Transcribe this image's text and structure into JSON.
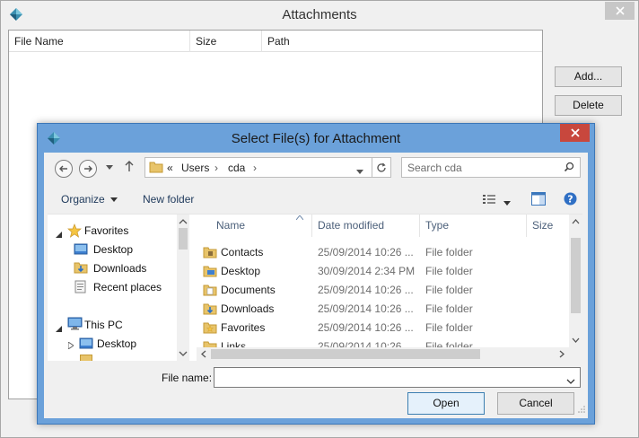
{
  "background_window": {
    "title": "Attachments",
    "columns": [
      "File Name",
      "Size",
      "Path"
    ],
    "add_label": "Add...",
    "delete_label": "Delete"
  },
  "dialog": {
    "title": "Select File(s) for Attachment",
    "breadcrumb": {
      "overflow": "«",
      "segments": [
        "Users",
        "cda"
      ]
    },
    "search_placeholder": "Search cda",
    "organize_label": "Organize",
    "new_folder_label": "New folder",
    "tree": [
      {
        "label": "Favorites",
        "icon": "star-icon"
      },
      {
        "label": "Desktop",
        "icon": "desktop-folder-icon"
      },
      {
        "label": "Downloads",
        "icon": "downloads-folder-icon"
      },
      {
        "label": "Recent places",
        "icon": "recent-places-icon"
      },
      {
        "label": "This PC",
        "icon": "computer-icon"
      },
      {
        "label": "Desktop",
        "icon": "desktop-folder-icon"
      }
    ],
    "columns": [
      "Name",
      "Date modified",
      "Type",
      "Size"
    ],
    "files": [
      {
        "name": "Contacts",
        "date": "25/09/2014 10:26 ...",
        "type": "File folder"
      },
      {
        "name": "Desktop",
        "date": "30/09/2014 2:34 PM",
        "type": "File folder"
      },
      {
        "name": "Documents",
        "date": "25/09/2014 10:26 ...",
        "type": "File folder"
      },
      {
        "name": "Downloads",
        "date": "25/09/2014 10:26 ...",
        "type": "File folder"
      },
      {
        "name": "Favorites",
        "date": "25/09/2014 10:26 ...",
        "type": "File folder"
      },
      {
        "name": "Links",
        "date": "25/09/2014 10:26 ...",
        "type": "File folder"
      }
    ],
    "file_name_label": "File name:",
    "file_name_value": "",
    "open_label": "Open",
    "cancel_label": "Cancel"
  },
  "colors": {
    "dialog_frame": "#6ba1da",
    "close_button": "#c8473d",
    "folder": "#e8c46a",
    "header_text": "#4c607a"
  }
}
